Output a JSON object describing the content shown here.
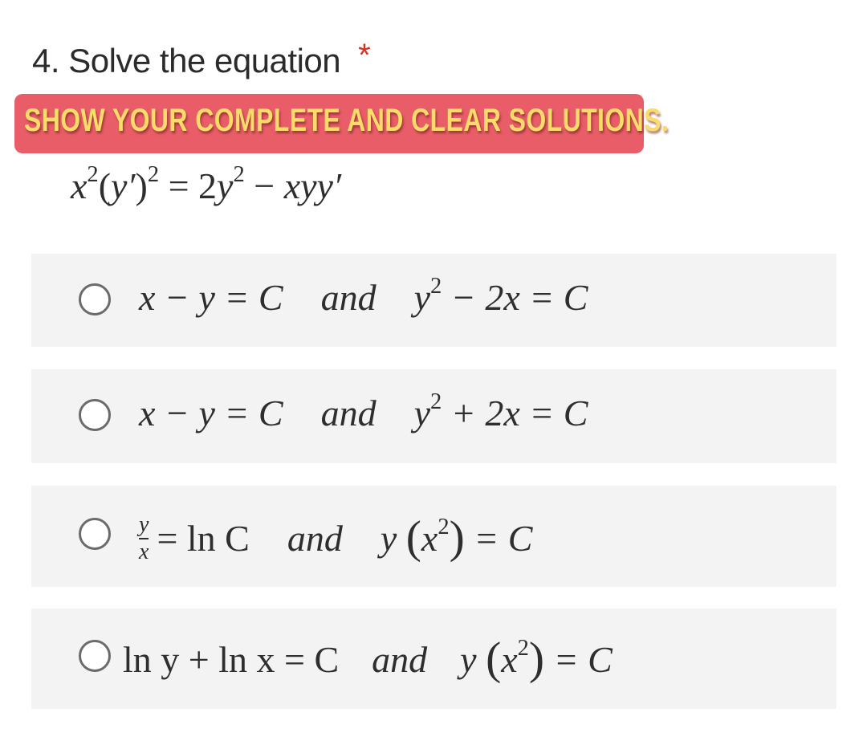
{
  "question": {
    "number_title": "4. Solve the equation",
    "required_marker": "*",
    "banner_text": "SHOW YOUR COMPLETE AND CLEAR SOLUTIONS.",
    "equation": {
      "lhs_base": "x",
      "lhs_exp": "2",
      "lhs_open": "(",
      "lhs_inner": "y′",
      "lhs_close": ")",
      "lhs_outer_exp": "2",
      "eq": " = ",
      "rhs_coef": "2",
      "rhs_var": "y",
      "rhs_exp": "2",
      "rhs_minus": " − ",
      "rhs_term": "xyy′"
    }
  },
  "colors": {
    "banner_bg": "#e85d67",
    "banner_text": "#fbdc6a",
    "required": "#d93025",
    "option_bg": "#f3f3f3"
  },
  "options": [
    {
      "part1": "x − y = C",
      "conj": "and",
      "part2_var": "y",
      "part2_exp": "2",
      "part2_rest": " − 2x = C",
      "selected": false
    },
    {
      "part1": "x − y = C",
      "conj": "and",
      "part2_var": "y",
      "part2_exp": "2",
      "part2_rest": " + 2x = C",
      "selected": false
    },
    {
      "frac_num": "y",
      "frac_den": "x",
      "part1_rest": "= ln C",
      "conj": "and",
      "part2_pre": "y ",
      "part2_open": "(",
      "part2_var": "x",
      "part2_exp": "2",
      "part2_close": ")",
      "part2_rest": " = C",
      "selected": false
    },
    {
      "part1": "ln y + ln x = C",
      "conj": "and",
      "part2_pre": "y ",
      "part2_open": "(",
      "part2_var": "x",
      "part2_exp": "2",
      "part2_close": ")",
      "part2_rest": " = C",
      "selected": false
    }
  ]
}
